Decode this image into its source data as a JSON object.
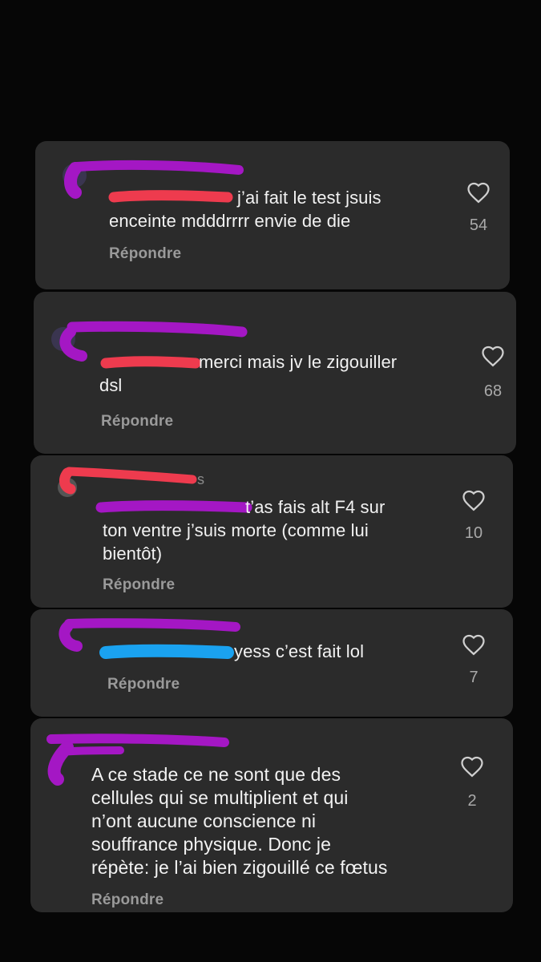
{
  "colors": {
    "background": "#060606",
    "card": "#2b2b2b",
    "text": "#f2f2f2",
    "muted": "#9a9a9a",
    "scribble_magenta": "#a417c4",
    "scribble_red": "#ee3b4e",
    "scribble_blue": "#1aa2f0"
  },
  "comments": [
    {
      "lines": [
        "j’ai fait le test jsuis",
        "enceinte mdddrrrr envie de die"
      ],
      "reply_label": "Répondre",
      "likes": "54",
      "heart_icon": "heart-outline-icon"
    },
    {
      "lines": [
        "merci mais jv le zigouiller",
        "dsl"
      ],
      "reply_label": "Répondre",
      "likes": "68",
      "heart_icon": "heart-outline-icon"
    },
    {
      "meta_suffix": "s",
      "lines": [
        "t’as fais alt F4 sur",
        "ton ventre j’suis morte (comme lui",
        "bientôt)"
      ],
      "reply_label": "Répondre",
      "likes": "10",
      "heart_icon": "heart-outline-icon"
    },
    {
      "lines": [
        "yess c’est fait lol"
      ],
      "reply_label": "Répondre",
      "likes": "7",
      "heart_icon": "heart-outline-icon"
    },
    {
      "lines": [
        "A ce stade ce ne sont que des",
        "cellules qui se multiplient et qui",
        "n’ont aucune conscience ni",
        "souffrance physique. Donc je",
        "répète: je l’ai bien zigouillé ce fœtus"
      ],
      "reply_label": "Répondre",
      "likes": "2",
      "heart_icon": "heart-outline-icon"
    }
  ]
}
